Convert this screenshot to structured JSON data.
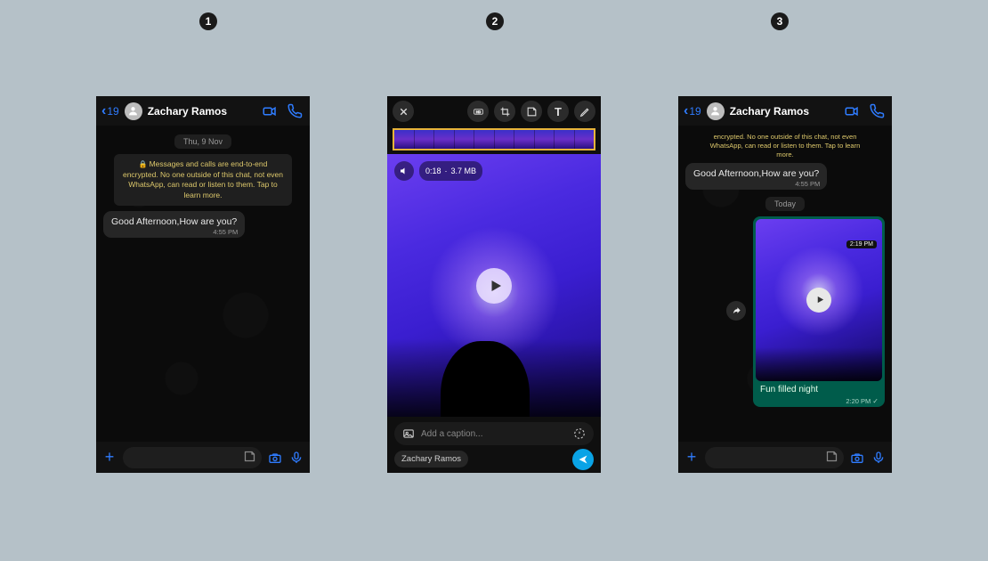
{
  "steps": {
    "one": "1",
    "two": "2",
    "three": "3"
  },
  "contact_name": "Zachary Ramos",
  "back_count": "19",
  "screen1": {
    "date": "Thu, 9 Nov",
    "encryption": "Messages and calls are end-to-end encrypted. No one outside of this chat, not even WhatsApp, can read or listen to them. Tap to learn more.",
    "msg_in": "Good Afternoon,How are you?",
    "msg_in_time": "4:55 PM"
  },
  "screen2": {
    "duration": "0:18",
    "size": "3.7 MB",
    "caption_placeholder": "Add a caption...",
    "recipient_chip": "Zachary Ramos"
  },
  "screen3": {
    "encryption_partial": "encrypted. No one outside of this chat, not even WhatsApp, can read or listen to them. Tap to learn more.",
    "msg_in": "Good Afternoon,How are you?",
    "msg_in_time": "4:55 PM",
    "date": "Today",
    "video_duration": "2:19 PM",
    "caption": "Fun filled night",
    "sent_time": "2:20 PM"
  }
}
